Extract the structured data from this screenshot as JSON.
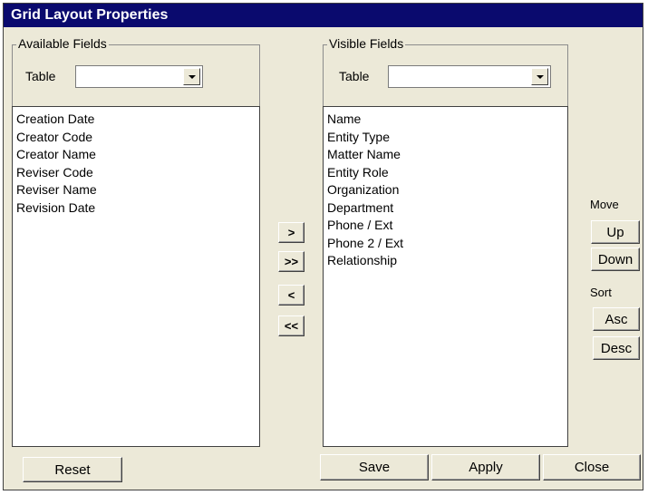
{
  "window": {
    "title": "Grid Layout Properties"
  },
  "available": {
    "group_title": "Available Fields",
    "table_label": "Table",
    "table_value": "",
    "items": [
      "Creation Date",
      "Creator Code",
      "Creator Name",
      "Reviser Code",
      "Reviser Name",
      "Revision Date"
    ]
  },
  "visible": {
    "group_title": "Visible Fields",
    "table_label": "Table",
    "table_value": "",
    "items": [
      "Name",
      "Entity Type",
      "Matter Name",
      "Entity Role",
      "Organization",
      "Department",
      "Phone / Ext",
      "Phone 2 / Ext",
      "Relationship"
    ]
  },
  "transfer": {
    "add": ">",
    "add_all": ">>",
    "remove": "<",
    "remove_all": "<<"
  },
  "move": {
    "label": "Move",
    "up": "Up",
    "down": "Down"
  },
  "sort": {
    "label": "Sort",
    "asc": "Asc",
    "desc": "Desc"
  },
  "footer": {
    "reset": "Reset",
    "save": "Save",
    "apply": "Apply",
    "close": "Close"
  }
}
